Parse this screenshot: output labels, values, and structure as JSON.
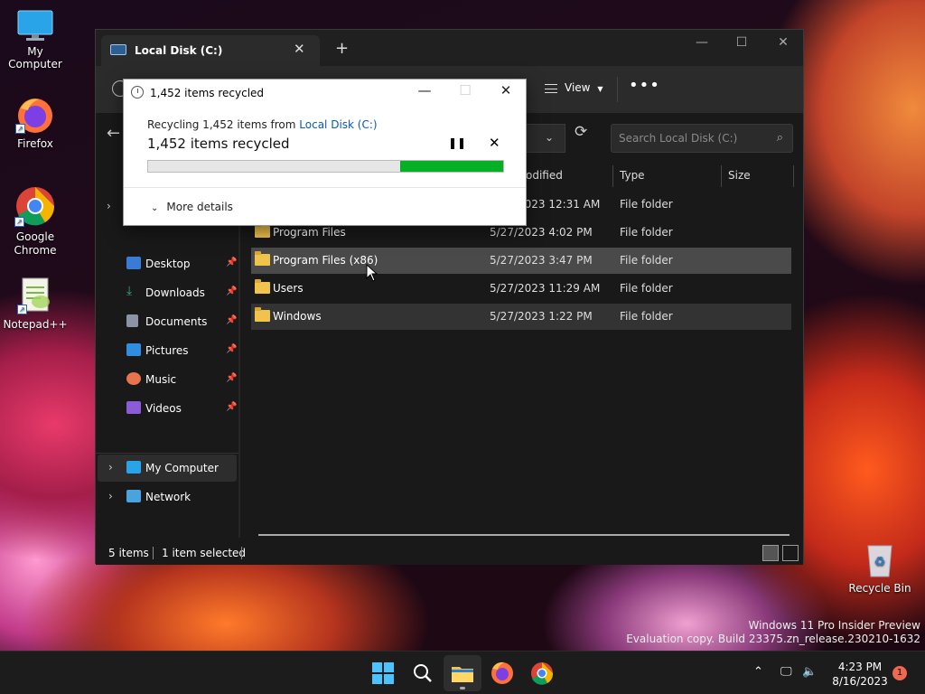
{
  "desktop": {
    "icons": [
      {
        "label": "My Computer"
      },
      {
        "label": "Firefox"
      },
      {
        "label": "Google Chrome"
      },
      {
        "label": "Notepad++"
      }
    ],
    "recycle_bin": "Recycle Bin",
    "watermark": {
      "line1": "Windows 11 Pro Insider Preview",
      "line2": "Evaluation copy. Build 23375.zn_release.230210-1632"
    }
  },
  "explorer": {
    "tab_title": "Local Disk (C:)",
    "tab_close": "✕",
    "new_tab": "+",
    "toolbar": {
      "view_label": "View",
      "more": "•••"
    },
    "search": {
      "placeholder": "Search Local Disk (C:)"
    },
    "nav": {
      "quick": [
        {
          "label": "Desktop",
          "color": "#3a7bd5"
        },
        {
          "label": "Downloads",
          "color": "#35a876"
        },
        {
          "label": "Documents",
          "color": "#8a94a6"
        },
        {
          "label": "Pictures",
          "color": "#2f8ee0"
        },
        {
          "label": "Music",
          "color": "#e8734c"
        },
        {
          "label": "Videos",
          "color": "#8a5cd8"
        }
      ],
      "pin": "📌",
      "my_computer": "My Computer",
      "network": "Network"
    },
    "columns": {
      "date": "odified",
      "type": "Type",
      "size": "Size"
    },
    "rows": [
      {
        "name": "",
        "date": "5/27/2023 12:31 AM",
        "type": "File folder"
      },
      {
        "name": "Program Files",
        "date": "5/27/2023 4:02 PM",
        "type": "File folder"
      },
      {
        "name": "Program Files (x86)",
        "date": "5/27/2023 3:47 PM",
        "type": "File folder"
      },
      {
        "name": "Users",
        "date": "5/27/2023 11:29 AM",
        "type": "File folder"
      },
      {
        "name": "Windows",
        "date": "5/27/2023 1:22 PM",
        "type": "File folder"
      }
    ],
    "status": {
      "count": "5 items",
      "selected": "1 item selected"
    }
  },
  "dialog": {
    "title": "1,452 items recycled",
    "line1_prefix": "Recycling 1,452 items from ",
    "line1_link": "Local Disk (C:)",
    "line2": "1,452 items recycled",
    "progress_fraction": 0.29,
    "more_details": "More details"
  },
  "taskbar": {
    "time": "4:23 PM",
    "date": "8/16/2023",
    "notifications": "1"
  }
}
